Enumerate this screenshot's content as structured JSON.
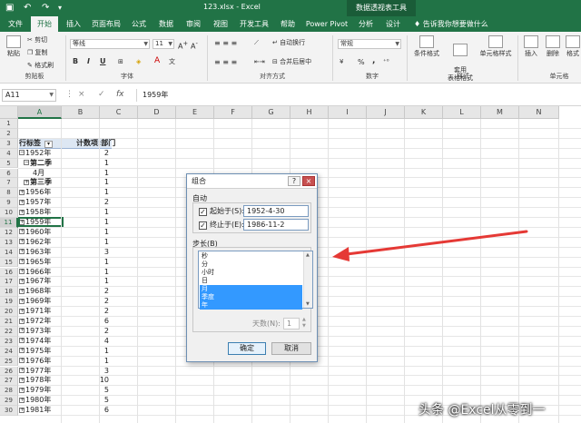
{
  "titlebar": {
    "doc_title": "123.xlsx - Excel",
    "context_title": "数据透视表工具",
    "save_icon": "save-icon",
    "undo_icon": "undo-icon",
    "redo_icon": "redo-icon"
  },
  "tabs": [
    {
      "label": "文件"
    },
    {
      "label": "开始",
      "active": true
    },
    {
      "label": "插入"
    },
    {
      "label": "页面布局"
    },
    {
      "label": "公式"
    },
    {
      "label": "数据"
    },
    {
      "label": "审阅"
    },
    {
      "label": "视图"
    },
    {
      "label": "开发工具"
    },
    {
      "label": "帮助"
    },
    {
      "label": "Power Pivot"
    },
    {
      "label": "分析"
    },
    {
      "label": "设计"
    }
  ],
  "tellme": "告诉我你想要做什么",
  "ribbon": {
    "clipboard": {
      "paste": "粘贴",
      "cut": "剪切",
      "copy": "复制",
      "format_painter": "格式刷",
      "label": "剪贴板"
    },
    "font": {
      "name": "等线",
      "size": "11",
      "bold": "B",
      "italic": "I",
      "underline": "U",
      "label": "字体"
    },
    "alignment": {
      "wrap": "自动换行",
      "merge": "合并后居中",
      "label": "对齐方式"
    },
    "number": {
      "format": "常规",
      "percent": "%",
      "comma": ",",
      "label": "数字"
    },
    "styles": {
      "conditional": "条件格式",
      "table": "套用\n表格格式",
      "cell": "单元格样式",
      "label": "样式"
    },
    "cells": {
      "insert": "插入",
      "delete": "删除",
      "format": "格式",
      "label": "单元格"
    }
  },
  "formulabar": {
    "namebox": "A11",
    "cancel": "×",
    "enter": "✓",
    "fx": "fx",
    "content": "1959年"
  },
  "columns": [
    "A",
    "B",
    "C",
    "D",
    "E",
    "F",
    "G",
    "H",
    "I",
    "J",
    "K",
    "L",
    "M",
    "N"
  ],
  "selected_column": "A",
  "selected_row": 11,
  "rows": [
    {
      "n": "1",
      "a": "",
      "b": ""
    },
    {
      "n": "2",
      "a": "",
      "b": ""
    },
    {
      "n": "3",
      "a": "行标签",
      "b": "计数项:部门",
      "header": true
    },
    {
      "n": "4",
      "a": "1952年",
      "b": "2",
      "box": "−",
      "indent": 0
    },
    {
      "n": "5",
      "a": "第二季",
      "b": "1",
      "box": "−",
      "indent": 1
    },
    {
      "n": "6",
      "a": "4月",
      "b": "1",
      "indent": 3
    },
    {
      "n": "7",
      "a": "第三季",
      "b": "1",
      "box": "+",
      "indent": 1
    },
    {
      "n": "8",
      "a": "1956年",
      "b": "1",
      "box": "+",
      "indent": 0
    },
    {
      "n": "9",
      "a": "1957年",
      "b": "2",
      "box": "+",
      "indent": 0
    },
    {
      "n": "10",
      "a": "1958年",
      "b": "1",
      "box": "+",
      "indent": 0
    },
    {
      "n": "11",
      "a": "1959年",
      "b": "1",
      "box": "+",
      "indent": 0
    },
    {
      "n": "12",
      "a": "1960年",
      "b": "1",
      "box": "+",
      "indent": 0
    },
    {
      "n": "13",
      "a": "1962年",
      "b": "1",
      "box": "+",
      "indent": 0
    },
    {
      "n": "14",
      "a": "1963年",
      "b": "3",
      "box": "+",
      "indent": 0
    },
    {
      "n": "15",
      "a": "1965年",
      "b": "1",
      "box": "+",
      "indent": 0
    },
    {
      "n": "16",
      "a": "1966年",
      "b": "1",
      "box": "+",
      "indent": 0
    },
    {
      "n": "17",
      "a": "1967年",
      "b": "1",
      "box": "+",
      "indent": 0
    },
    {
      "n": "18",
      "a": "1968年",
      "b": "2",
      "box": "+",
      "indent": 0
    },
    {
      "n": "19",
      "a": "1969年",
      "b": "2",
      "box": "+",
      "indent": 0
    },
    {
      "n": "20",
      "a": "1971年",
      "b": "2",
      "box": "+",
      "indent": 0
    },
    {
      "n": "21",
      "a": "1972年",
      "b": "6",
      "box": "+",
      "indent": 0
    },
    {
      "n": "22",
      "a": "1973年",
      "b": "2",
      "box": "+",
      "indent": 0
    },
    {
      "n": "23",
      "a": "1974年",
      "b": "4",
      "box": "+",
      "indent": 0
    },
    {
      "n": "24",
      "a": "1975年",
      "b": "1",
      "box": "+",
      "indent": 0
    },
    {
      "n": "25",
      "a": "1976年",
      "b": "1",
      "box": "+",
      "indent": 0
    },
    {
      "n": "26",
      "a": "1977年",
      "b": "3",
      "box": "+",
      "indent": 0
    },
    {
      "n": "27",
      "a": "1978年",
      "b": "10",
      "box": "+",
      "indent": 0
    },
    {
      "n": "28",
      "a": "1979年",
      "b": "5",
      "box": "+",
      "indent": 0
    },
    {
      "n": "29",
      "a": "1980年",
      "b": "5",
      "box": "+",
      "indent": 0
    },
    {
      "n": "30",
      "a": "1981年",
      "b": "6",
      "box": "+",
      "indent": 0
    }
  ],
  "dialog": {
    "title": "组合",
    "help": "?",
    "close": "×",
    "auto_section": "自动",
    "start_label": "起始于(S):",
    "start_value": "1952-4-30",
    "start_checked": "✓",
    "end_label": "终止于(E):",
    "end_value": "1986-11-2",
    "end_checked": "✓",
    "step_section": "步长(B)",
    "steps": [
      {
        "label": "秒",
        "selected": false
      },
      {
        "label": "分",
        "selected": false
      },
      {
        "label": "小时",
        "selected": false
      },
      {
        "label": "日",
        "selected": false
      },
      {
        "label": "月",
        "selected": true
      },
      {
        "label": "季度",
        "selected": true
      },
      {
        "label": "年",
        "selected": true
      }
    ],
    "days_label": "天数(N):",
    "days_value": "1",
    "ok": "确定",
    "cancel": "取消"
  },
  "annotation": {
    "arrow_color": "#e53935"
  },
  "watermark": "头条 @Excel从零到一",
  "colors": {
    "excel_green": "#217346",
    "selection_blue": "#3399ff"
  }
}
